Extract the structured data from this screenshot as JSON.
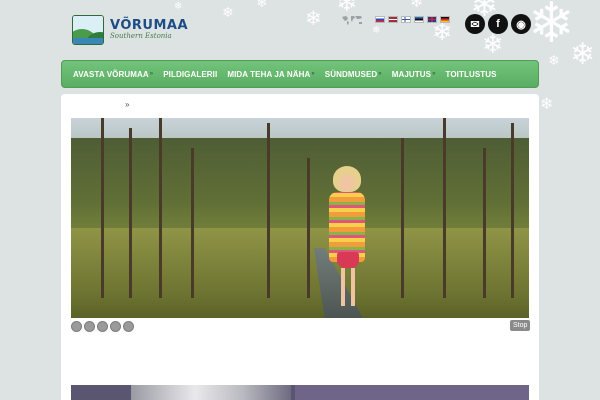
{
  "header": {
    "logo_title": "VÕRUMAA",
    "logo_subtitle": "Southern Estonia",
    "world_icon": "world-map-icon",
    "languages": [
      {
        "code": "ru",
        "colors": [
          "#ffffff",
          "#2a4bbf",
          "#d42b2b"
        ]
      },
      {
        "code": "lv",
        "colors": [
          "#9e3039",
          "#ffffff",
          "#9e3039"
        ]
      },
      {
        "code": "fi",
        "colors": [
          "#ffffff",
          "#2f5aa8"
        ]
      },
      {
        "code": "et",
        "colors": [
          "#2f6ac2",
          "#111111",
          "#ffffff"
        ]
      },
      {
        "code": "en",
        "colors": [
          "#1f3d8a",
          "#ffffff",
          "#cc2233"
        ]
      },
      {
        "code": "de",
        "colors": [
          "#111111",
          "#d42b2b",
          "#f2c21b"
        ]
      }
    ],
    "social": [
      {
        "name": "email",
        "glyph": "✉"
      },
      {
        "name": "facebook",
        "glyph": "f"
      },
      {
        "name": "rss",
        "glyph": "◉"
      }
    ]
  },
  "nav": {
    "items": [
      {
        "label": "AVASTA VÕRUMAA",
        "has_submenu": true
      },
      {
        "label": "PILDIGALERII",
        "has_submenu": false
      },
      {
        "label": "MIDA TEHA JA NÄHA",
        "has_submenu": true
      },
      {
        "label": "SÜNDMUSED",
        "has_submenu": true
      },
      {
        "label": "MAJUTUS",
        "has_submenu": true
      },
      {
        "label": "TOITLUSTUS",
        "has_submenu": false
      }
    ],
    "submenu_glyph": "»"
  },
  "breadcrumb": {
    "separator": "»"
  },
  "slider": {
    "stop_label": "Stop",
    "slide_count": 5
  },
  "colors": {
    "nav_green": "#64b76c",
    "background": "#dde2e3"
  }
}
